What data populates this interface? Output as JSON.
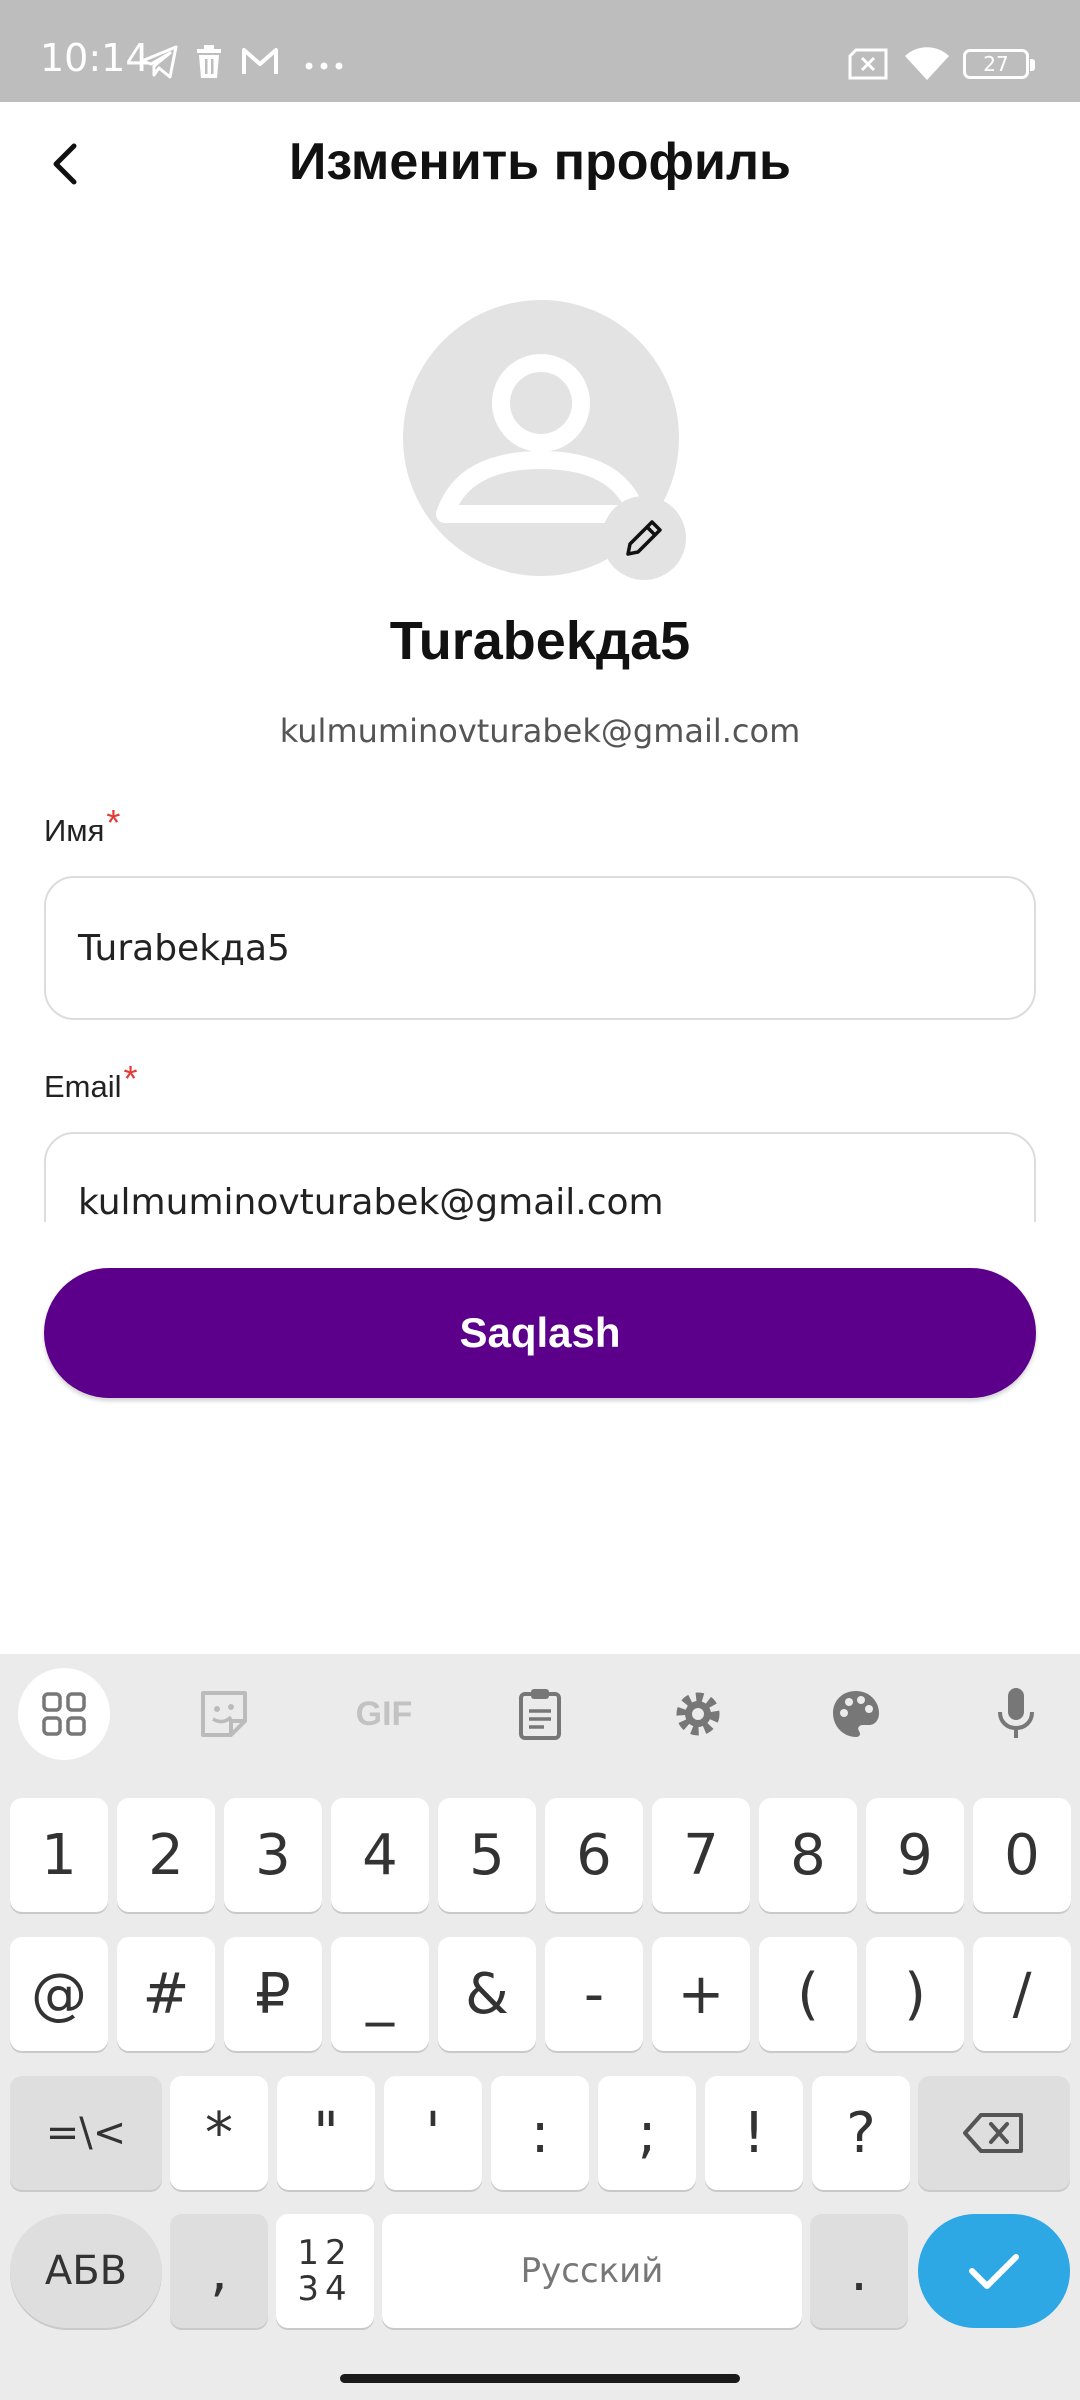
{
  "status_bar": {
    "time": "10:14",
    "battery": "27"
  },
  "header": {
    "title": "Изменить профиль"
  },
  "profile": {
    "name": "Turabekда5",
    "email": "kulmuminovturabek@gmail.com"
  },
  "form": {
    "name_label": "Имя",
    "name_value": "Turabekда5",
    "email_label": "Email",
    "email_value": "kulmuminovturabek@gmail.com",
    "required_mark": "*"
  },
  "save_button": {
    "label": "Saqlash"
  },
  "colors": {
    "primary": "#5c008c",
    "required": "#e53935",
    "enter_key": "#2ea8e5",
    "status_bar": "#bdbdbd"
  },
  "keyboard": {
    "toolbar_icons": [
      "apps-grid-icon",
      "sticker-icon",
      "gif-icon",
      "clipboard-icon",
      "gear-icon",
      "palette-icon",
      "microphone-icon"
    ],
    "toolbar_gif": "GIF",
    "row1": [
      "1",
      "2",
      "3",
      "4",
      "5",
      "6",
      "7",
      "8",
      "9",
      "0"
    ],
    "row2": [
      "@",
      "#",
      "₽",
      "_",
      "&",
      "-",
      "+",
      "(",
      ")",
      "/"
    ],
    "row3": [
      "*",
      "\"",
      "'",
      ":",
      ";",
      "!",
      "?"
    ],
    "symbols_key": "=\\<",
    "abc_key": "АБВ",
    "comma": ",",
    "numpad_top": "12",
    "numpad_bottom": "34",
    "space": "Русский",
    "period": "."
  }
}
